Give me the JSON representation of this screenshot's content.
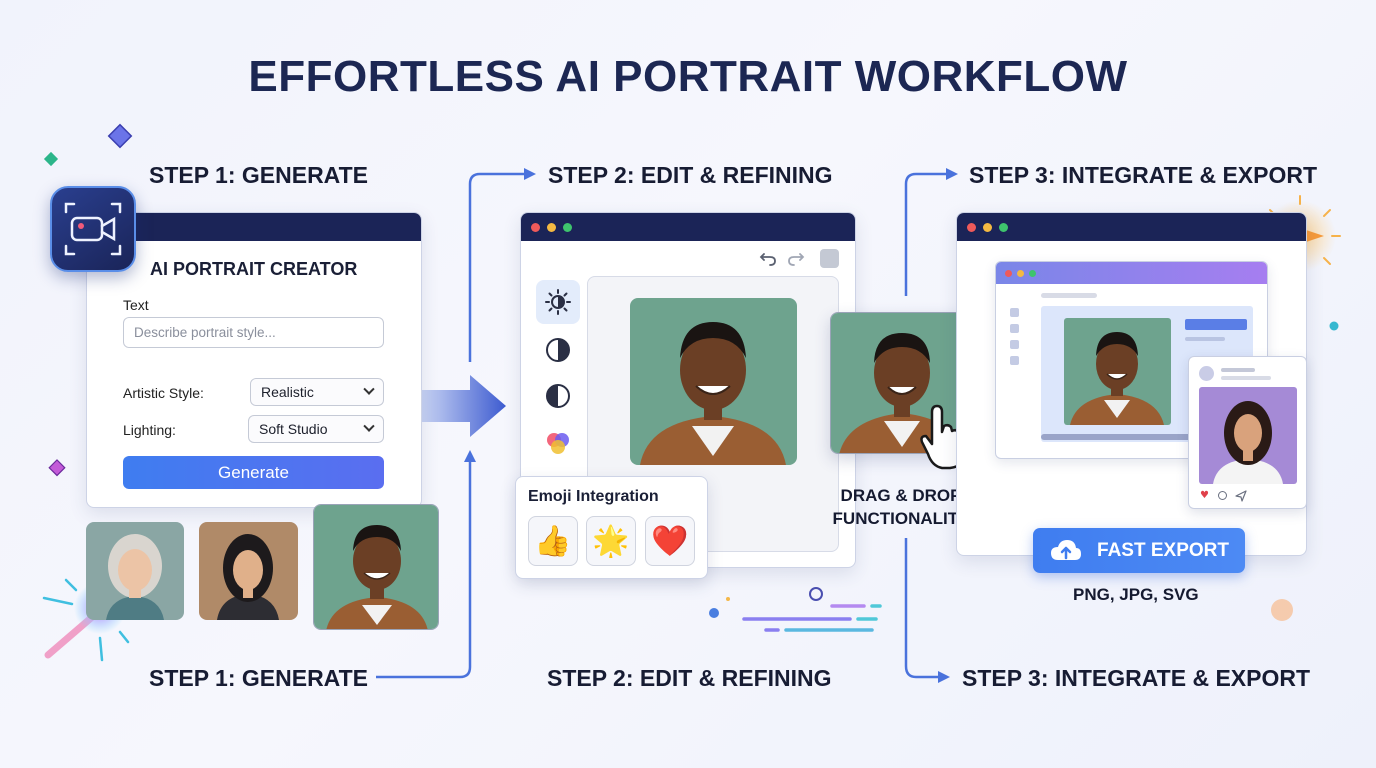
{
  "title": "EFFORTLESS AI PORTRAIT WORKFLOW",
  "steps_top": {
    "step1": "STEP 1: GENERATE",
    "step2": "STEP 2: EDIT & REFINING",
    "step3": "STEP 3: INTEGRATE & EXPORT"
  },
  "steps_bottom": {
    "step1": "STEP 1: GENERATE",
    "step2": "STEP 2: EDIT & REFINING",
    "step3": "STEP 3: INTEGRATE & EXPORT"
  },
  "generator": {
    "app_icon": "camera-icon",
    "title": "AI PORTRAIT CREATOR",
    "text_label": "Text",
    "text_placeholder": "Describe portrait style...",
    "style_label": "Artistic Style:",
    "style_value": "Realistic",
    "lighting_label": "Lighting:",
    "lighting_value": "Soft Studio",
    "generate_label": "Generate"
  },
  "editor": {
    "tools": [
      "brightness-icon",
      "contrast-icon",
      "contrast-half-icon",
      "color-palette-icon"
    ],
    "toolbar": [
      "undo-icon",
      "redo-icon",
      "square-icon"
    ],
    "emoji_title": "Emoji Integration",
    "emojis": [
      "👍",
      "🌟",
      "❤️"
    ]
  },
  "drag_drop": {
    "line1": "DRAG & DROP",
    "line2": "FUNCTIONALITY"
  },
  "export": {
    "button_label": "FAST EXPORT",
    "button_icon": "cloud-upload-icon",
    "formats": "PNG, JPG, SVG"
  },
  "colors": {
    "navy": "#1b2457",
    "accent_blue": "#3f7df0",
    "arrow_blue": "#4a6fd8"
  }
}
